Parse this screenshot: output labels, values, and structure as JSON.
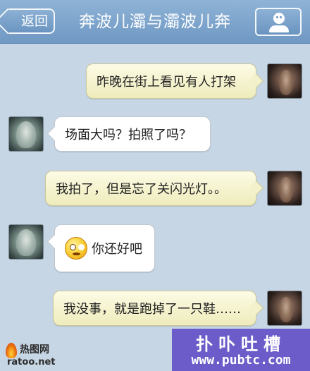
{
  "header": {
    "back_label": "返回",
    "title": "奔波儿灞与灞波儿奔",
    "profile_icon": "person-icon"
  },
  "messages": [
    {
      "direction": "outgoing",
      "text": "昨晚在街上看见有人打架"
    },
    {
      "direction": "incoming",
      "text": "场面大吗？拍照了吗？"
    },
    {
      "direction": "outgoing",
      "text": "我拍了，但是忘了关闪光灯。。"
    },
    {
      "direction": "incoming",
      "emoji": "angry-face-emoji",
      "text": "你还好吧"
    },
    {
      "direction": "outgoing",
      "text": "我没事，就是跑掉了一只鞋……"
    }
  ],
  "watermarks": {
    "left_name": "热图网",
    "left_url": "ratoo.net",
    "right_title": "扑卟吐槽",
    "right_url": "www.pubtc.com",
    "right_bg": "#6b5cc9"
  },
  "colors": {
    "chat_bg": "#c7d6e4",
    "header_bg": "#7ea6cd",
    "outgoing_bubble": "#f3f1cc",
    "incoming_bubble": "#ffffff"
  }
}
